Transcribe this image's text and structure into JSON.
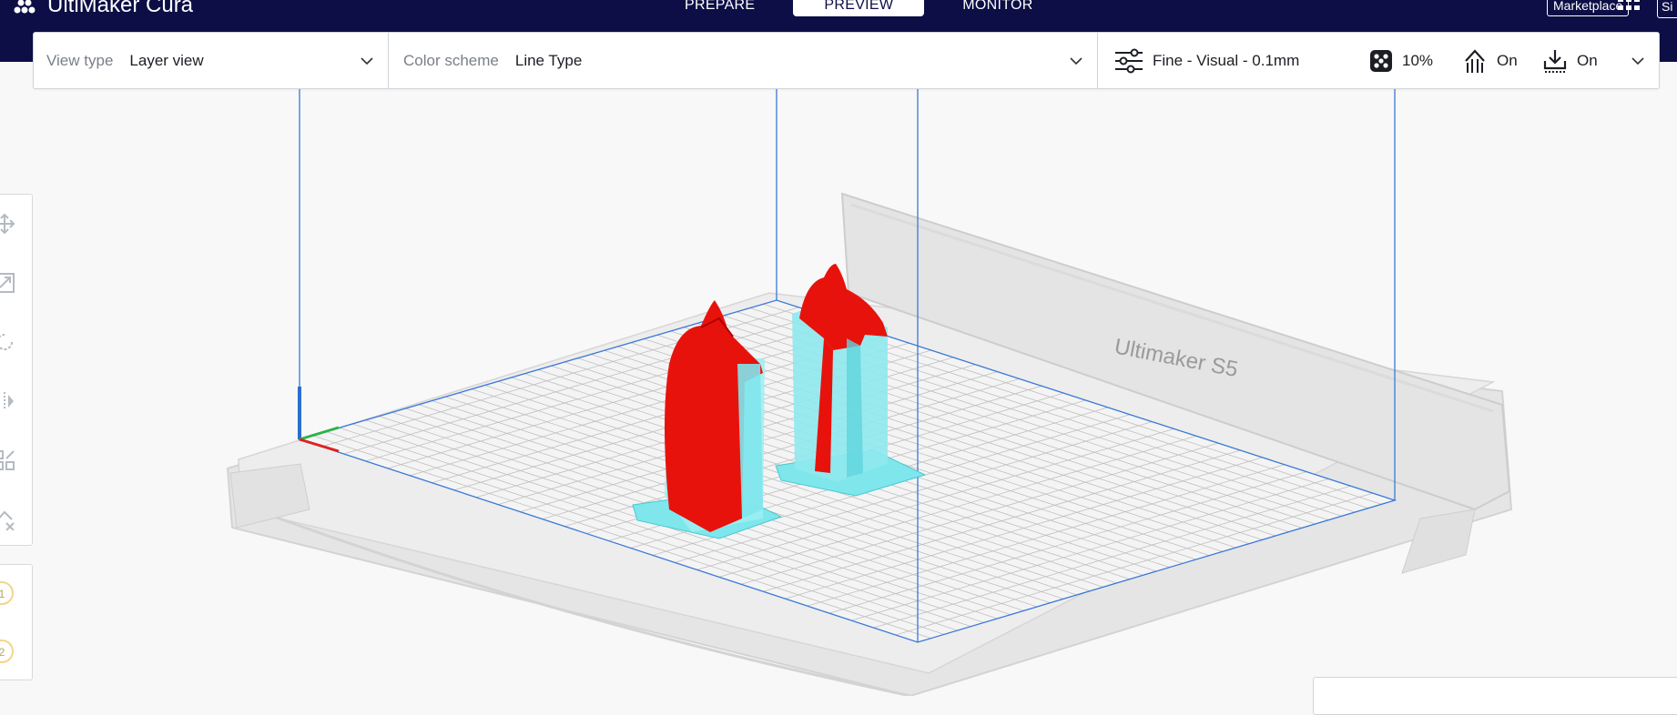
{
  "app": {
    "name": "UltiMaker Cura",
    "logo_icon": "ultimaker-logo-icon"
  },
  "stages": [
    {
      "label": "PREPARE",
      "active": false
    },
    {
      "label": "PREVIEW",
      "active": true
    },
    {
      "label": "MONITOR",
      "active": false
    }
  ],
  "header": {
    "marketplace_label": "Marketplace",
    "apps_icon": "grid-apps-icon",
    "signin_label": "Si"
  },
  "view_type": {
    "label": "View type",
    "value": "Layer view"
  },
  "color_scheme": {
    "label": "Color scheme",
    "value": "Line Type"
  },
  "print_settings": {
    "profile": "Fine - Visual - 0.1mm",
    "infill": "10%",
    "support": "On",
    "adhesion": "On"
  },
  "viewport": {
    "printer_label": "Ultimaker S5",
    "colors": {
      "wall": "#e8120c",
      "support": "#7fe6ec",
      "build_volume": "#3a78d8",
      "grid": "#bfbfbf"
    }
  },
  "extruders": [
    {
      "label": "1"
    },
    {
      "label": "2"
    }
  ],
  "tools": [
    "move-icon",
    "scale-icon",
    "rotate-icon",
    "mirror-icon",
    "per-model-settings-icon",
    "support-blocker-icon"
  ]
}
